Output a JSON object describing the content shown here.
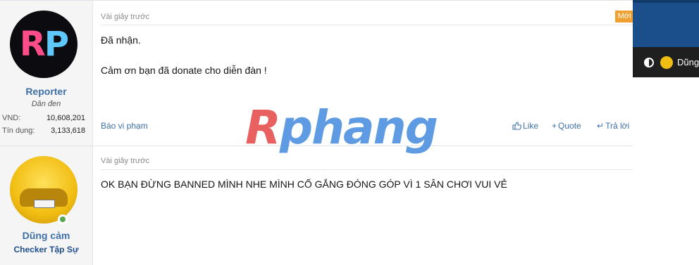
{
  "post1": {
    "username": "Reporter",
    "user_title": "Dân đen",
    "stats": [
      {
        "label": "VND:",
        "value": "10,608,201"
      },
      {
        "label": "Tín dụng:",
        "value": "3,133,618"
      }
    ],
    "date": "Vài giây trước",
    "new_badge": "Mới",
    "messages": [
      "Đã nhận.",
      "Cảm ơn bạn đã donate cho diễn đàn !"
    ],
    "report_label": "Báo vi phạm",
    "actions": {
      "like": "Like",
      "quote": "Quote",
      "reply": "Trả lời"
    }
  },
  "post2": {
    "username": "Dũng cảm",
    "user_title": "Checker Tập Sự",
    "date": "Vài giây trước",
    "message": "OK BẠN ĐỪNG BANNED MÌNH NHE MÌNH CỐ GẮNG ĐÓNG GÓP VÌ 1 SÂN CHƠI VUI VẺ"
  },
  "top_right": {
    "username": "Dũng"
  },
  "watermark": {
    "part1": "R",
    "part2": "phang"
  },
  "avatar_text": {
    "r": "R",
    "p": "P"
  },
  "icons": {
    "like": "thumbs-up-icon",
    "quote": "plus-icon",
    "reply": "reply-arrow-icon",
    "contrast": "contrast-icon",
    "online": "online-dot-icon"
  }
}
